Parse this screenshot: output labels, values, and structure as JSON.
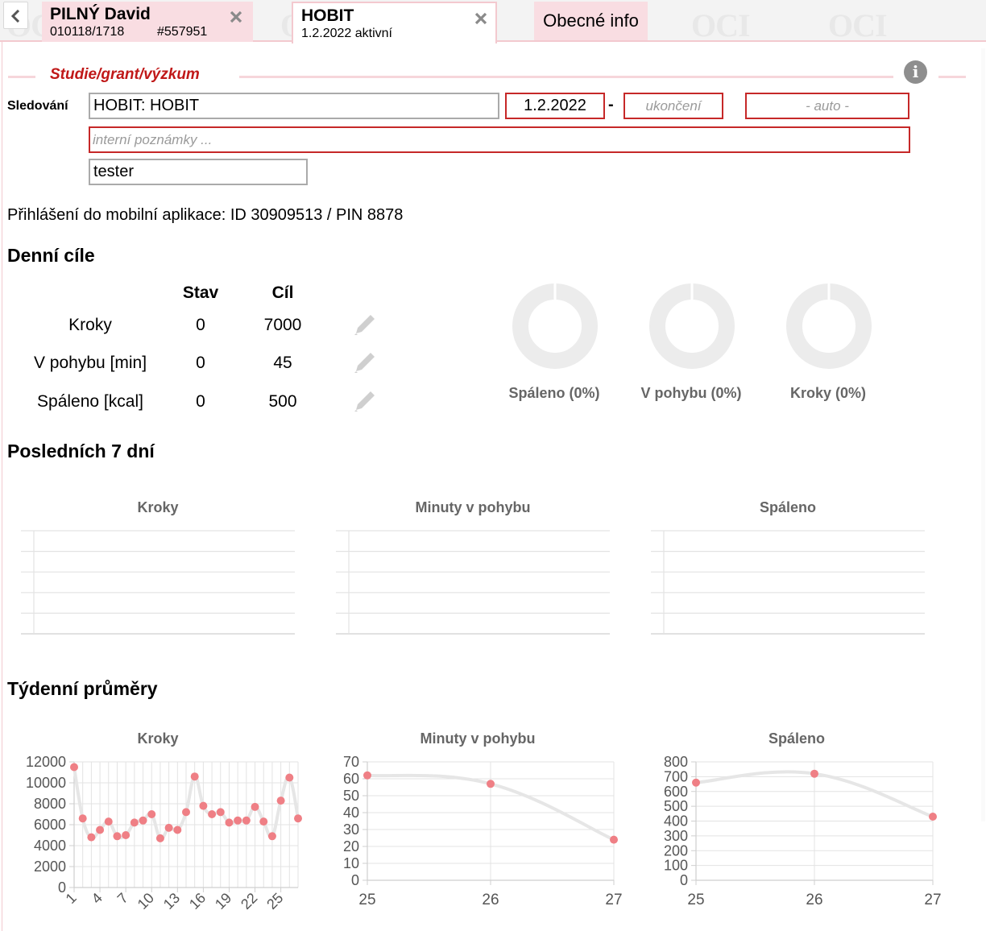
{
  "tabs": {
    "patient": {
      "name": "PILNÝ David",
      "birth_id": "010118/1718",
      "record_no": "#557951"
    },
    "study": {
      "name": "HOBIT",
      "status": "1.2.2022 aktivní"
    },
    "general_info": "Obecné info",
    "watermark": "OCI"
  },
  "form": {
    "section_title": "Studie/grant/výzkum",
    "tracking_label": "Sledování",
    "study_value": "HOBIT: HOBIT",
    "start_date": "1.2.2022",
    "dash": "-",
    "end_placeholder": "ukončení",
    "auto_placeholder": "- auto -",
    "notes_placeholder": "interní poznámky ...",
    "role_value": "tester"
  },
  "login_text": "Přihlášení do mobilní aplikace: ID 30909513 / PIN 8878",
  "daily": {
    "heading": "Denní cíle",
    "col_state": "Stav",
    "col_goal": "Cíl",
    "rows": [
      {
        "label": "Kroky",
        "state": "0",
        "goal": "7000"
      },
      {
        "label": "V pohybu [min]",
        "state": "0",
        "goal": "45"
      },
      {
        "label": "Spáleno [kcal]",
        "state": "0",
        "goal": "500"
      }
    ],
    "donuts": [
      {
        "label": "Spáleno (0%)",
        "fraction": 0
      },
      {
        "label": "V pohybu (0%)",
        "fraction": 0
      },
      {
        "label": "Kroky (0%)",
        "fraction": 0
      }
    ]
  },
  "last7": {
    "heading": "Posledních 7 dní",
    "titles": [
      "Kroky",
      "Minuty v pohybu",
      "Spáleno"
    ]
  },
  "weekly": {
    "heading": "Týdenní průměry",
    "titles": [
      "Kroky",
      "Minuty v pohybu",
      "Spáleno"
    ]
  },
  "colors": {
    "accent": "#c62828",
    "tab_pink": "#f9dde2",
    "point": "#ef7f85",
    "line": "#e6e6e6"
  },
  "chart_data": [
    {
      "type": "line",
      "title": "Kroky",
      "series": [],
      "grid": true
    },
    {
      "type": "line",
      "title": "Minuty v pohybu",
      "series": [],
      "grid": true
    },
    {
      "type": "line",
      "title": "Spáleno",
      "series": [],
      "grid": true
    },
    {
      "type": "line",
      "title": "Kroky",
      "x": [
        1,
        2,
        3,
        4,
        5,
        6,
        7,
        8,
        9,
        10,
        11,
        12,
        13,
        14,
        15,
        16,
        17,
        18,
        19,
        20,
        21,
        22,
        23,
        24,
        25,
        26,
        27
      ],
      "xticks": [
        "1",
        "4",
        "7",
        "10",
        "13",
        "16",
        "19",
        "22",
        "25"
      ],
      "yticks": [
        "0",
        "2000",
        "4000",
        "6000",
        "8000",
        "10000",
        "12000"
      ],
      "ylim": [
        0,
        12000
      ],
      "series": [
        {
          "values": [
            11500,
            6600,
            4800,
            5500,
            6300,
            4900,
            5000,
            6200,
            6400,
            7000,
            4700,
            5700,
            5500,
            7200,
            10600,
            7800,
            7000,
            7200,
            6200,
            6400,
            6400,
            7700,
            6300,
            4900,
            8300,
            10500,
            6600
          ]
        }
      ]
    },
    {
      "type": "line",
      "title": "Minuty v pohybu",
      "x": [
        25,
        26,
        27
      ],
      "xticks": [
        "25",
        "26",
        "27"
      ],
      "yticks": [
        "0",
        "10",
        "20",
        "30",
        "40",
        "50",
        "60",
        "70"
      ],
      "ylim": [
        0,
        70
      ],
      "series": [
        {
          "values": [
            62,
            57,
            24
          ]
        }
      ]
    },
    {
      "type": "line",
      "title": "Spáleno",
      "x": [
        25,
        26,
        27
      ],
      "xticks": [
        "25",
        "26",
        "27"
      ],
      "yticks": [
        "0",
        "100",
        "200",
        "300",
        "400",
        "500",
        "600",
        "700",
        "800"
      ],
      "ylim": [
        0,
        800
      ],
      "series": [
        {
          "values": [
            660,
            720,
            430
          ]
        }
      ]
    }
  ]
}
